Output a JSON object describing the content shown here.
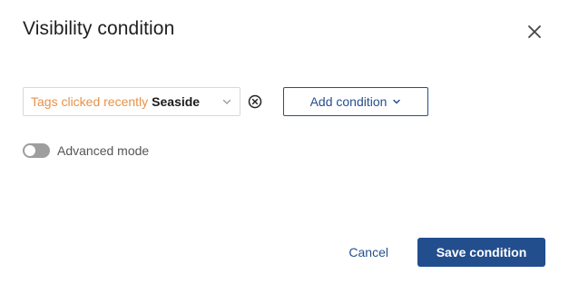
{
  "dialog": {
    "title": "Visibility condition",
    "close_icon": "close-icon"
  },
  "condition": {
    "prefix": "Tags clicked recently",
    "value": "Seaside",
    "chevron_icon": "chevron-down-icon",
    "remove_icon": "circle-x-icon"
  },
  "add_condition": {
    "label": "Add condition",
    "icon": "chevron-down-icon"
  },
  "advanced_mode": {
    "label": "Advanced mode",
    "enabled": false
  },
  "footer": {
    "cancel_label": "Cancel",
    "save_label": "Save condition"
  },
  "colors": {
    "accent": "#234e8e",
    "condition_prefix": "#e8914a",
    "toggle_off": "#9e9e9e"
  }
}
